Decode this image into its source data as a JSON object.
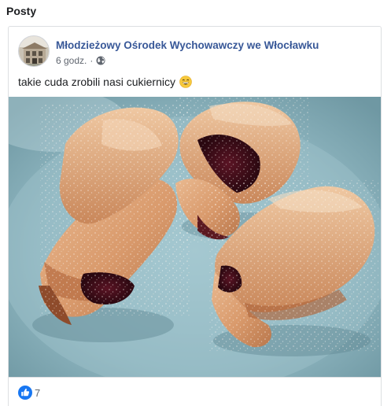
{
  "section": {
    "title": "Posty"
  },
  "post": {
    "page_name": "Młodzieżowy Ośrodek Wychowawczy we Włocławku",
    "time": "6 godz.",
    "separator": "·",
    "privacy_icon": "globe-icon",
    "text": "takie cuda zrobili nasi cukiernicy",
    "emoji_icon": "grinning-face-icon",
    "image_subject": "rogaliki",
    "reactions": {
      "icon": "like-icon",
      "count": "7"
    }
  },
  "colors": {
    "link": "#385898",
    "meta": "#616770",
    "like_blue": "#1877f2",
    "plate": "#8fb6c0"
  }
}
